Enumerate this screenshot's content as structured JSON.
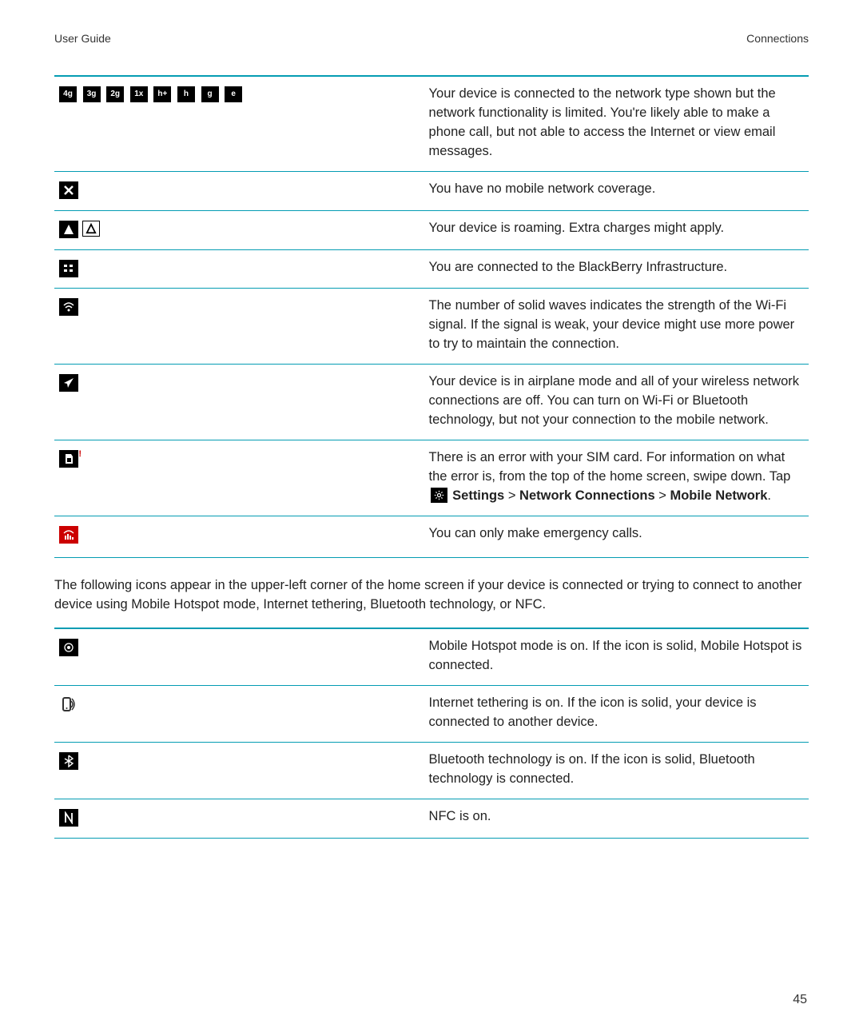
{
  "header": {
    "left": "User Guide",
    "right": "Connections"
  },
  "table1": {
    "rows": [
      {
        "icons": [
          "4g",
          "3g",
          "2g",
          "1x",
          "h+",
          "h",
          "g",
          "e"
        ],
        "desc": "Your device is connected to the network type shown but the network functionality is limited. You're likely able to make a phone call, but not able to access the Internet or view email messages."
      },
      {
        "type": "no-coverage",
        "desc": "You have no mobile network coverage."
      },
      {
        "type": "roaming",
        "desc": "Your device is roaming. Extra charges might apply."
      },
      {
        "type": "bb-infra",
        "desc": "You are connected to the BlackBerry Infrastructure."
      },
      {
        "type": "wifi",
        "desc": "The number of solid waves indicates the strength of the Wi-Fi signal. If the signal is weak, your device might use more power to try to maintain the connection."
      },
      {
        "type": "airplane",
        "desc": "Your device is in airplane mode and all of your wireless network connections are off. You can turn on Wi-Fi or Bluetooth technology, but not your connection to the mobile network."
      },
      {
        "type": "sim-error",
        "desc_prefix": "There is an error with your SIM card. For information on what the error is, from the top of the home screen, swipe down. Tap ",
        "path1": "Settings",
        "sep": " > ",
        "path2": "Network Connections",
        "path3": "Mobile Network",
        "period": "."
      },
      {
        "type": "emergency",
        "desc": "You can only make emergency calls."
      }
    ]
  },
  "mid_para": "The following icons appear in the upper-left corner of the home screen if your device is connected or trying to connect to another device using Mobile Hotspot mode, Internet tethering, Bluetooth technology, or NFC.",
  "table2": {
    "rows": [
      {
        "type": "hotspot",
        "desc": "Mobile Hotspot mode is on. If the icon is solid, Mobile Hotspot is connected."
      },
      {
        "type": "tether",
        "desc": "Internet tethering is on. If the icon is solid, your device is connected to another device."
      },
      {
        "type": "bluetooth",
        "desc": "Bluetooth technology is on. If the icon is solid, Bluetooth technology is connected."
      },
      {
        "type": "nfc",
        "desc": "NFC is on."
      }
    ]
  },
  "page_number": "45"
}
